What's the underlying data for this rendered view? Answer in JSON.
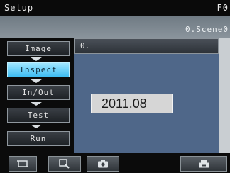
{
  "window": {
    "title": "Setup",
    "title_right": "F0"
  },
  "scene": {
    "label": "0.Scene0"
  },
  "menu": {
    "items": [
      {
        "label": "Image",
        "active": false
      },
      {
        "label": "Inspect",
        "active": true
      },
      {
        "label": "In/Out",
        "active": false
      },
      {
        "label": "Test",
        "active": false
      },
      {
        "label": "Run",
        "active": false
      }
    ]
  },
  "panel": {
    "header": "0.",
    "date_text": "2011.08"
  },
  "toolbar": {
    "icons": [
      "display-mode-icon",
      "zoom-icon",
      "camera-icon",
      "save-icon"
    ]
  },
  "colors": {
    "active_tab": "#3fbdf2",
    "panel_bg": "#4f6789",
    "scene_bar": "#7d878f"
  }
}
